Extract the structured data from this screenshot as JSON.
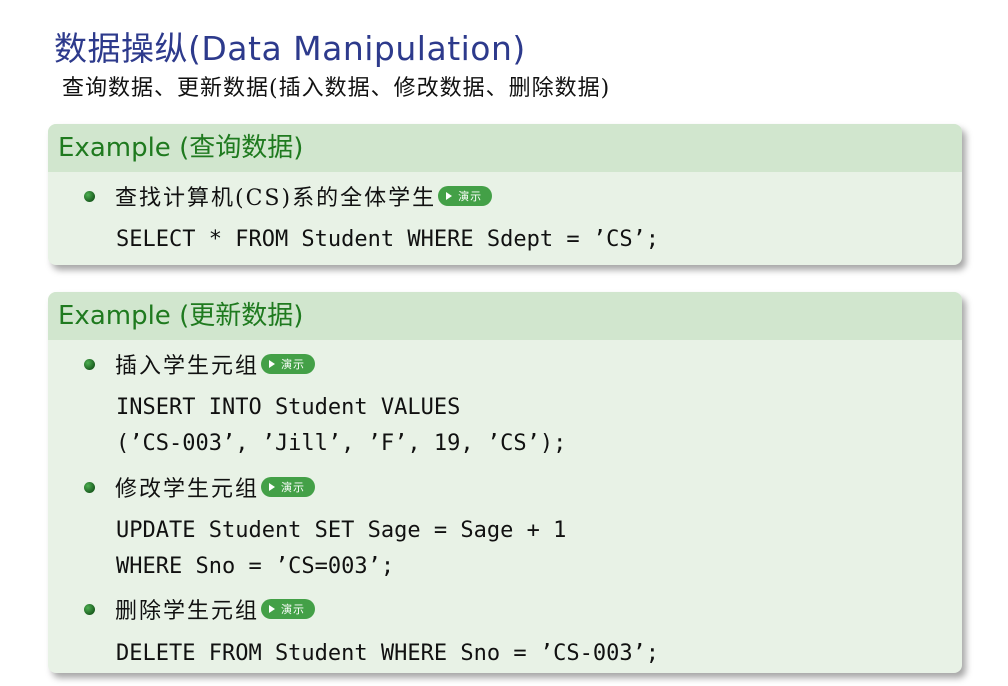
{
  "frame": {
    "title": "数据操纵(Data Manipulation)",
    "subtitle": "查询数据、更新数据(插入数据、修改数据、删除数据)"
  },
  "blocks": [
    {
      "title": "Example (查询数据)",
      "items": [
        {
          "text": "查找计算机(CS)系的全体学生",
          "demo_label": "演示",
          "code": [
            "SELECT * FROM Student WHERE Sdept = ’CS’;"
          ]
        }
      ]
    },
    {
      "title": "Example (更新数据)",
      "items": [
        {
          "text": "插入学生元组",
          "demo_label": "演示",
          "code": [
            "INSERT INTO Student VALUES",
            "(’CS-003’, ’Jill’, ’F’, 19, ’CS’);"
          ]
        },
        {
          "text": "修改学生元组",
          "demo_label": "演示",
          "code": [
            "UPDATE Student SET Sage = Sage + 1",
            "WHERE Sno = ’CS=003’;"
          ]
        },
        {
          "text": "删除学生元组",
          "demo_label": "演示",
          "code": [
            "DELETE FROM Student WHERE Sno = ’CS-003’;"
          ]
        }
      ]
    }
  ],
  "colors": {
    "title": "#2d3a8c",
    "block_title_text": "#1f7a1f",
    "block_title_bg": "#d1e6ce",
    "block_body_bg": "#e8f2e6",
    "demo_button": "#43a047"
  },
  "icons": {
    "bullet": "green-ball-icon",
    "demo": "play-triangle-icon"
  }
}
